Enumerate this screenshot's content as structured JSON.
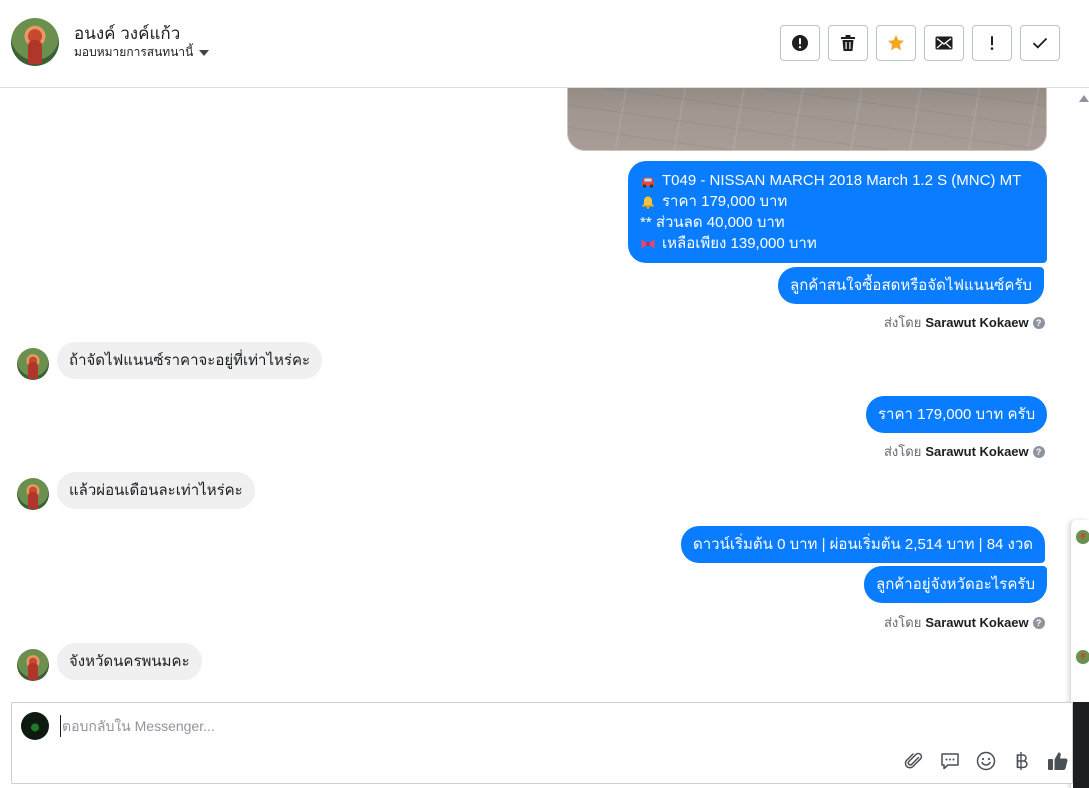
{
  "header": {
    "contact_name": "อนงค์ วงค์แก้ว",
    "assign_label": "มอบหมายการสนทนานี้",
    "toolbar": [
      {
        "name": "mark-spam-button",
        "icon": "alert-circle-icon"
      },
      {
        "name": "delete-button",
        "icon": "trash-icon"
      },
      {
        "name": "star-button",
        "icon": "star-icon"
      },
      {
        "name": "mark-unread-button",
        "icon": "envelope-icon"
      },
      {
        "name": "follow-up-button",
        "icon": "exclamation-icon"
      },
      {
        "name": "mark-done-button",
        "icon": "checkmark-icon"
      }
    ],
    "star_color": "#f5a623"
  },
  "messages": {
    "car_card": {
      "line1": "T049 - NISSAN MARCH 2018 March 1.2 S (MNC) MT",
      "line2": "ราคา 179,000 บาท",
      "line3": "** ส่วนลด 40,000 บาท",
      "line4": "เหลือเพียง 139,000 บาท"
    },
    "out_finance_question": "ลูกค้าสนใจซื้อสดหรือจัดไฟแนนซ์ครับ",
    "sent_by_label": "ส่งโดย",
    "agent_name": "Sarawut Kokaew",
    "in_finance_price": "ถ้าจัดไฟแนนซ์ราคาจะอยู่ที่เท่าไหร่คะ",
    "out_price": "ราคา 179,000 บาท ครับ",
    "in_monthly": "แล้วผ่อนเดือนละเท่าไหร่คะ",
    "out_terms": "ดาวน์เริ่มต้น 0 บาท | ผ่อนเริ่มต้น 2,514 บาท | 84 งวด",
    "out_province_question": "ลูกค้าอยู่จังหวัดอะไรครับ",
    "in_province": "จังหวัดนครพนมคะ"
  },
  "composer": {
    "placeholder": "ตอบกลับใน Messenger...",
    "value": "",
    "tools": [
      "paperclip-icon",
      "saved-replies-icon",
      "emoji-icon",
      "baht-icon",
      "thumbs-up-icon"
    ]
  },
  "colors": {
    "outgoing_bubble": "#0a7cff",
    "incoming_bubble": "#f0f0f0"
  }
}
